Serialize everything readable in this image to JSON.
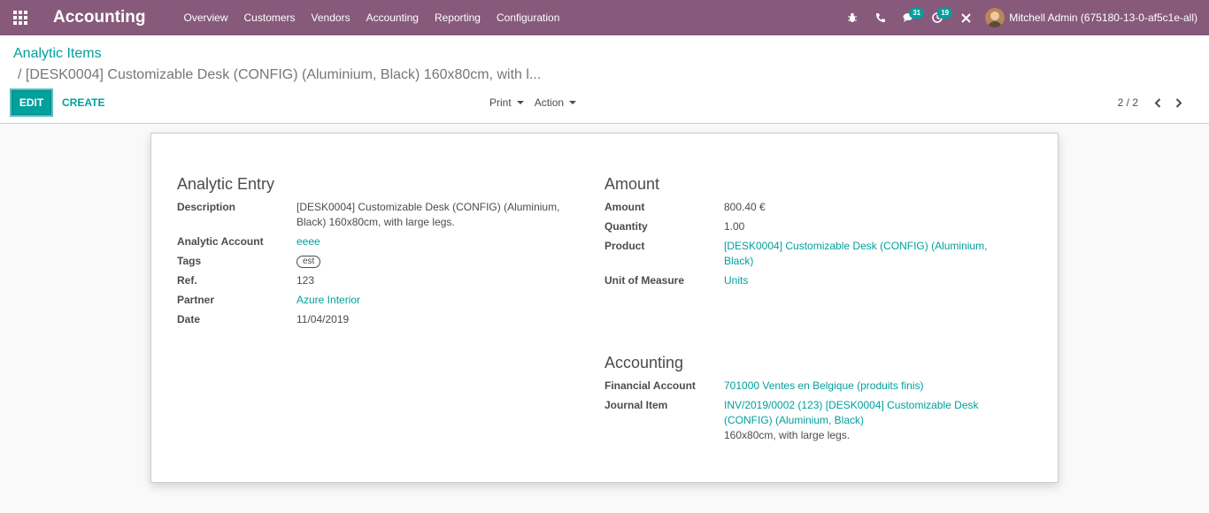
{
  "navbar": {
    "app_name": "Accounting",
    "menu": [
      "Overview",
      "Customers",
      "Vendors",
      "Accounting",
      "Reporting",
      "Configuration"
    ],
    "messages_count": "31",
    "activities_count": "19",
    "user_name": "Mitchell Admin (675180-13-0-af5c1e-all)"
  },
  "control_panel": {
    "breadcrumb_root": "Analytic Items",
    "breadcrumb_current": "/ [DESK0004] Customizable Desk (CONFIG) (Aluminium, Black) 160x80cm, with l...",
    "edit_label": "EDIT",
    "create_label": "CREATE",
    "print_label": "Print",
    "action_label": "Action",
    "pager": "2 / 2"
  },
  "form": {
    "analytic_entry": {
      "title": "Analytic Entry",
      "description_label": "Description",
      "description_line1": "[DESK0004] Customizable Desk (CONFIG) (Aluminium,",
      "description_line2": "Black) 160x80cm, with large legs.",
      "account_label": "Analytic Account",
      "account_value": "eeee",
      "tags_label": "Tags",
      "tags_value": "est",
      "ref_label": "Ref.",
      "ref_value": "123",
      "partner_label": "Partner",
      "partner_value": "Azure Interior",
      "date_label": "Date",
      "date_value": "11/04/2019"
    },
    "amount": {
      "title": "Amount",
      "amount_label": "Amount",
      "amount_value": "800.40 €",
      "quantity_label": "Quantity",
      "quantity_value": "1.00",
      "product_label": "Product",
      "product_line1": "[DESK0004] Customizable Desk (CONFIG) (Aluminium,",
      "product_line2": "Black)",
      "uom_label": "Unit of Measure",
      "uom_value": "Units"
    },
    "accounting": {
      "title": "Accounting",
      "financial_label": "Financial Account",
      "financial_value": "701000 Ventes en Belgique (produits finis)",
      "journal_label": "Journal Item",
      "journal_line1": "INV/2019/0002 (123) [DESK0004] Customizable Desk",
      "journal_line2": "(CONFIG) (Aluminium, Black)",
      "journal_line3": "160x80cm, with large legs."
    }
  }
}
